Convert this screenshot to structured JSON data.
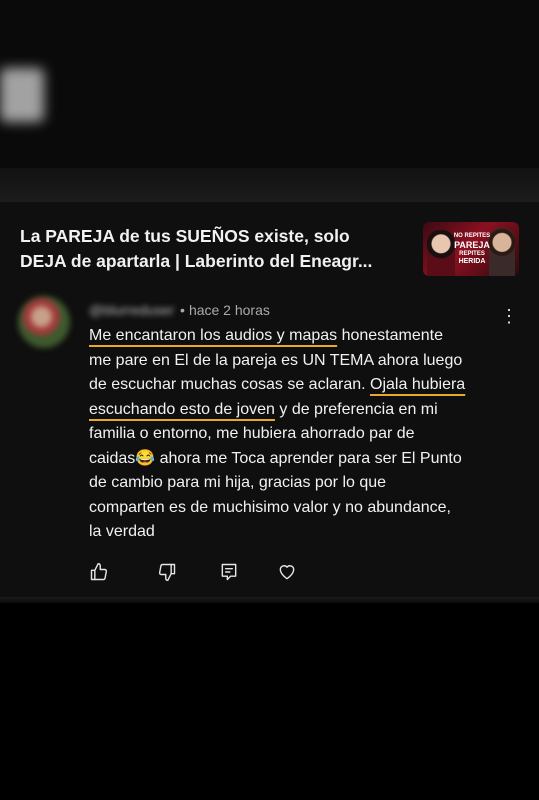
{
  "video": {
    "title_line1": "La PAREJA de tus SUEÑOS existe, solo",
    "title_line2": "DEJA de apartarla | Laberinto del Eneagr...",
    "thumbnail": {
      "line1": "NO REPITES",
      "line2": "PAREJA",
      "line3": "REPITES",
      "line4": "HERIDA"
    }
  },
  "comment": {
    "timestamp": "hace 2 horas",
    "lines": [
      [
        "Me encantaron  los audios y mapas",
        " honestamente"
      ],
      [
        "me pare en El de la pareja es UN TEMA ahora luego"
      ],
      [
        "de escuchar muchas cosas se aclaran. ",
        "Ojala hubiera"
      ],
      [
        "escuchando esto de joven",
        " y de preferencia en mi"
      ],
      [
        "familia o entorno, me hubiera ahorrado par de"
      ],
      [
        "caidas",
        "😂",
        " ahora me Toca aprender para ser El Punto"
      ],
      [
        "de cambio para mi hija, gracias por lo que"
      ],
      [
        "comparten es de muchisimo valor y no abundance,"
      ],
      [
        "la verdad"
      ]
    ],
    "highlight_color": "#e8a92a"
  },
  "actions": {
    "like_icon": "thumbs-up-icon",
    "dislike_icon": "thumbs-down-icon",
    "reply_icon": "reply-icon",
    "heart_icon": "heart-icon"
  },
  "colors": {
    "background": "#000000",
    "card": "#0f0f0f",
    "text": "#f1f1f1",
    "secondary_text": "#aaaaaa"
  }
}
